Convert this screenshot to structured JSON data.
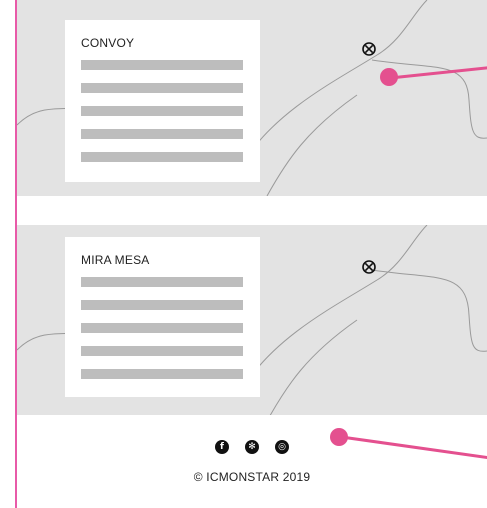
{
  "locations": [
    {
      "name": "CONVOY",
      "text_line_count": 5,
      "marker_icon": "location-marker-x-icon"
    },
    {
      "name": "MIRA MESA",
      "text_line_count": 5,
      "marker_icon": "location-marker-x-icon"
    }
  ],
  "footer": {
    "social": [
      {
        "icon": "facebook-icon",
        "glyph": "f"
      },
      {
        "icon": "yelp-icon",
        "glyph": "✻"
      },
      {
        "icon": "instagram-icon",
        "glyph": "◎"
      }
    ],
    "copyright": "© ICMONSTAR 2019"
  },
  "colors": {
    "accent": "#e4508f",
    "frame_border": "#e85aa8",
    "map_background": "#e3e3e3",
    "placeholder_bar": "#bdbdbd",
    "text": "#222222"
  }
}
